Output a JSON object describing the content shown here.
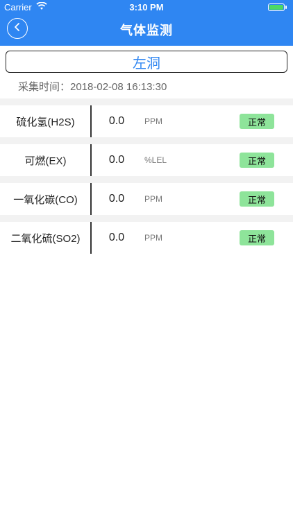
{
  "status_bar": {
    "carrier": "Carrier",
    "time": "3:10 PM"
  },
  "nav": {
    "title": "气体监测",
    "back_icon": "chevron-left-icon"
  },
  "location": "左洞",
  "collect_time": "采集时间：2018-02-08 16:13:30",
  "rows": [
    {
      "name": "硫化氢(H2S)",
      "value": "0.0",
      "unit": "PPM",
      "status": "正常"
    },
    {
      "name": "可燃(EX)",
      "value": "0.0",
      "unit": "%LEL",
      "status": "正常"
    },
    {
      "name": "一氧化碳(CO)",
      "value": "0.0",
      "unit": "PPM",
      "status": "正常"
    },
    {
      "name": "二氧化硫(SO2)",
      "value": "0.0",
      "unit": "PPM",
      "status": "正常"
    }
  ],
  "colors": {
    "accent": "#2f86f2",
    "status_ok": "#8ee49a"
  }
}
